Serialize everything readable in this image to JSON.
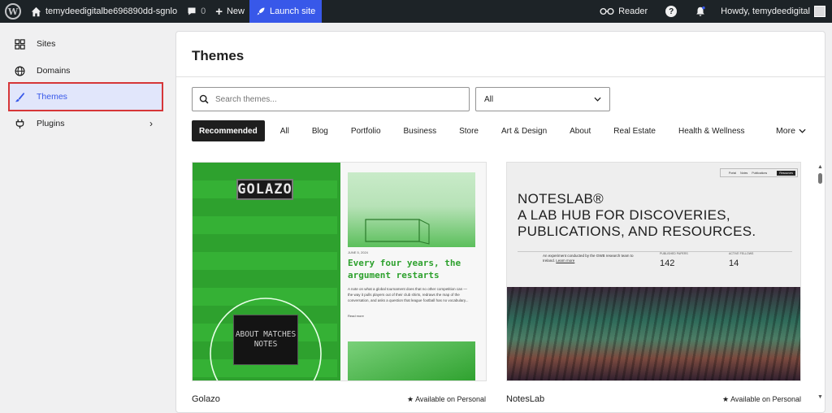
{
  "adminbar": {
    "site_name": "temydeedigitalbe696890dd-sgnlo",
    "comments_count": "0",
    "new_label": "New",
    "launch_label": "Launch site",
    "reader_label": "Reader",
    "help_label": "?",
    "howdy_label": "Howdy, temydeedigital"
  },
  "sidebar": {
    "items": [
      {
        "label": "Sites",
        "icon": "grid-icon"
      },
      {
        "label": "Domains",
        "icon": "globe-icon"
      },
      {
        "label": "Themes",
        "icon": "brush-icon"
      },
      {
        "label": "Plugins",
        "icon": "plug-icon"
      }
    ]
  },
  "main": {
    "title": "Themes",
    "search_placeholder": "Search themes...",
    "filter_value": "All",
    "tabs": [
      "Recommended",
      "All",
      "Blog",
      "Portfolio",
      "Business",
      "Store",
      "Art & Design",
      "About",
      "Real Estate",
      "Health & Wellness"
    ],
    "more_label": "More"
  },
  "themes": [
    {
      "name": "Golazo",
      "availability": "Available on Personal",
      "preview": {
        "logo": "GOLAZO",
        "box_text": "ABOUT MATCHES NOTES",
        "date": "JUNE 5, 2024",
        "headline": "Every four years, the argument restarts",
        "body": "A note on what a global tournament does that no other competition can — the way it pulls players out of their club shirts, redraws the map of the conversation, and asks a question that league football has no vocabulary...",
        "read_more": "Read more"
      }
    },
    {
      "name": "NotesLab",
      "availability": "Available on Personal",
      "preview": {
        "nav": [
          "Portal",
          "Notes",
          "Publications"
        ],
        "nav_button": "Resources",
        "title_line1": "NOTESLAB®",
        "title_line2": "A LAB HUB FOR DISCOVERIES,",
        "title_line3": "PUBLICATIONS, AND RESOURCES.",
        "description": "An experiment conducted by the GWB research team to Ireland.",
        "description_link": "Learn more",
        "stat1_label": "PUBLISHED PAPERS",
        "stat1_value": "142",
        "stat2_label": "ACTIVE FELLOWS",
        "stat2_value": "14"
      }
    }
  ],
  "colors": {
    "adminbar_bg": "#1d2327",
    "accent": "#3858e9",
    "highlight_border": "#d63638",
    "golazo_green": "#2ea12e"
  }
}
